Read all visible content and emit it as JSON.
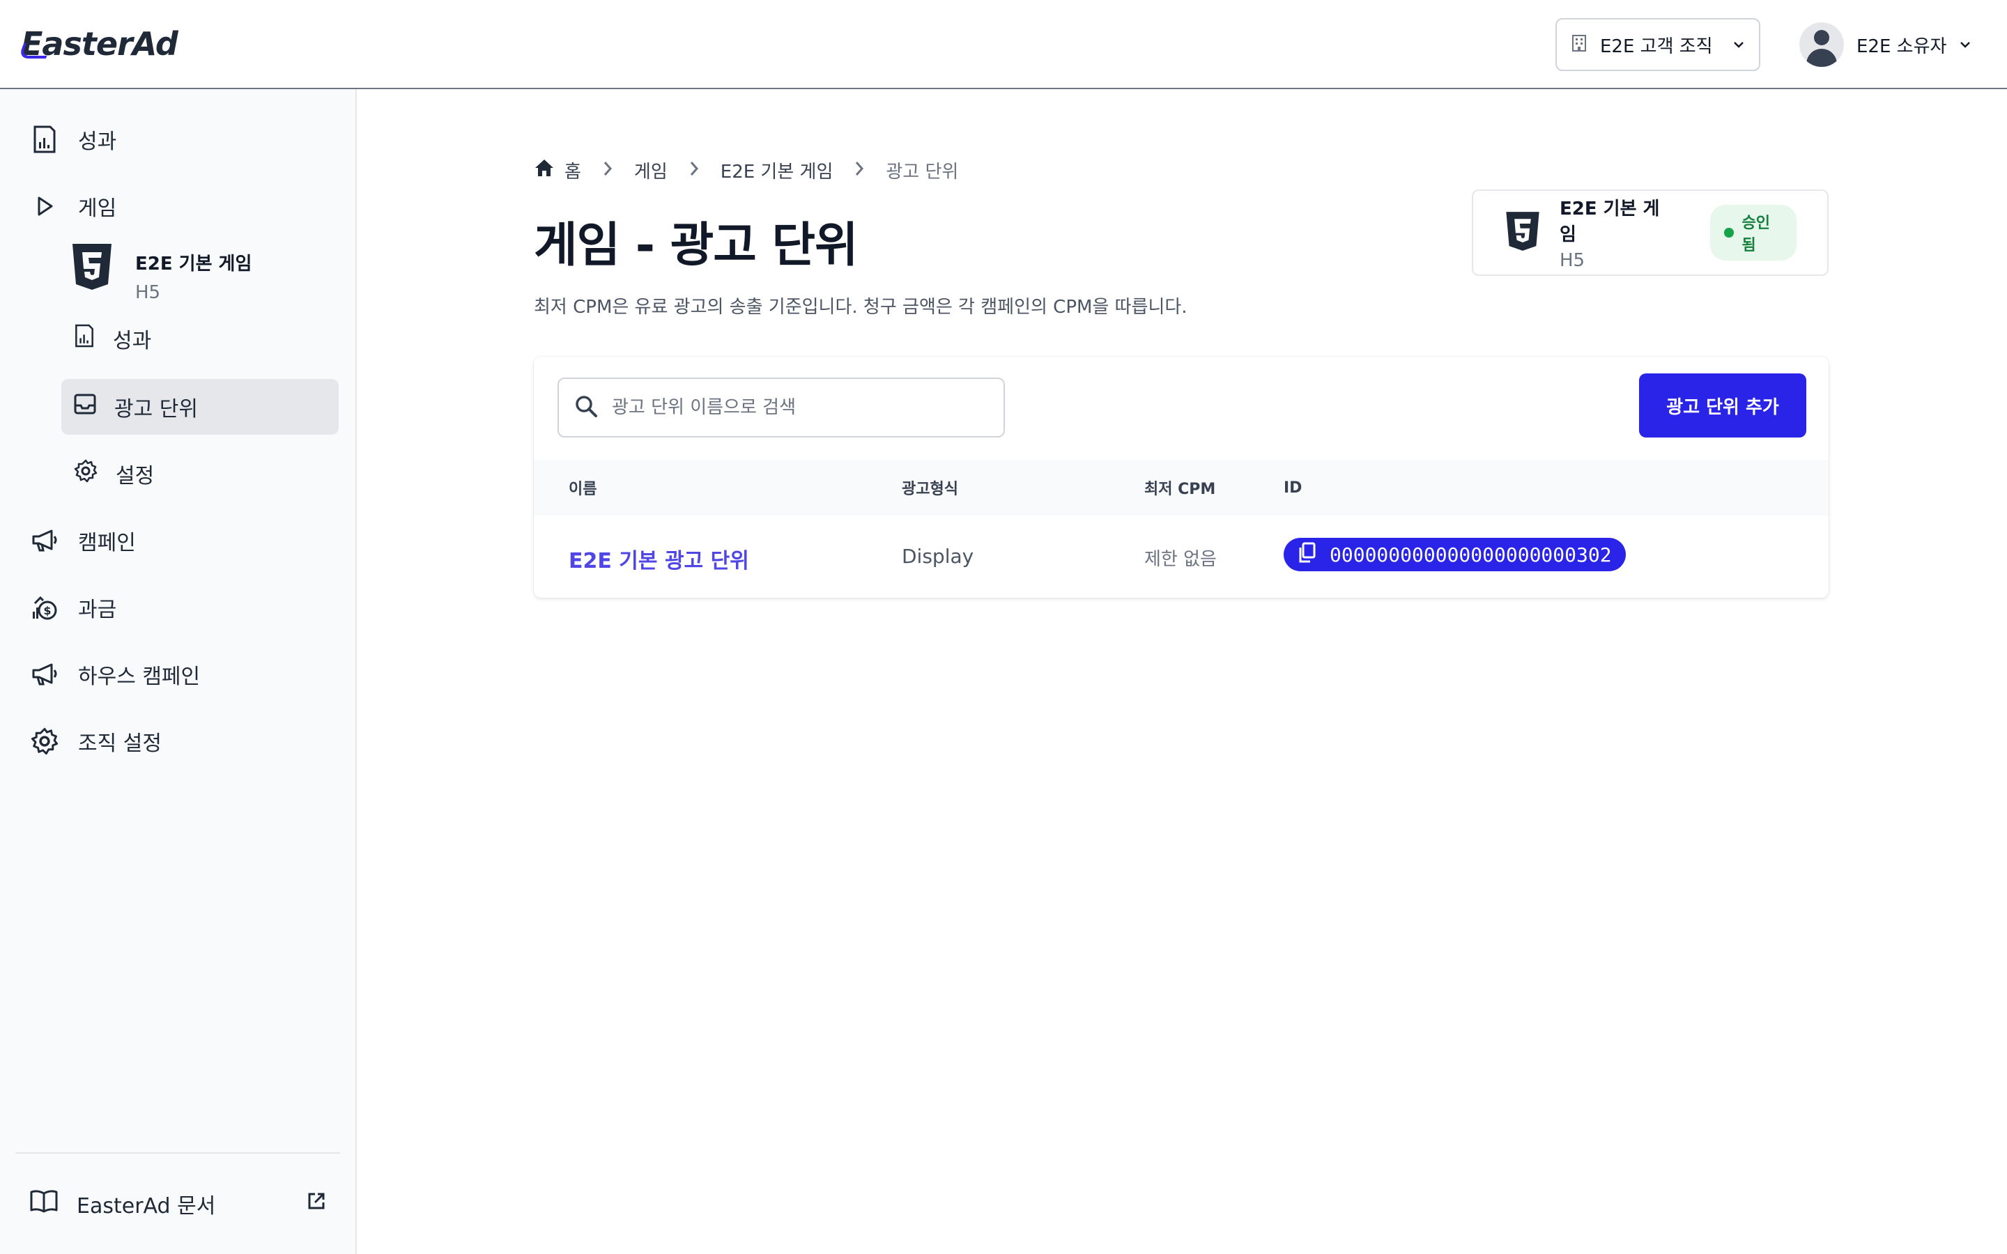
{
  "app": {
    "logo_text": "EasterAd"
  },
  "header": {
    "org_selector": {
      "label": "E2E 고객 조직",
      "icon": "building-icon"
    },
    "user": {
      "name": "E2E 소유자",
      "icon": "user-avatar-icon"
    }
  },
  "sidebar": {
    "items": [
      {
        "label": "성과",
        "icon": "report-chart-icon"
      },
      {
        "label": "게임",
        "icon": "play-icon"
      },
      {
        "label": "캠페인",
        "icon": "megaphone-icon"
      },
      {
        "label": "과금",
        "icon": "billing-icon"
      },
      {
        "label": "하우스 캠페인",
        "icon": "megaphone-icon"
      },
      {
        "label": "조직 설정",
        "icon": "gear-icon"
      }
    ],
    "game": {
      "name": "E2E 기본 게임",
      "platform": "H5",
      "icon": "html5-icon"
    },
    "game_subitems": [
      {
        "label": "성과",
        "icon": "report-chart-icon"
      },
      {
        "label": "광고 단위",
        "icon": "inbox-icon",
        "active": true
      },
      {
        "label": "설정",
        "icon": "gear-icon"
      }
    ],
    "docs": {
      "label": "EasterAd 문서",
      "icon": "book-icon",
      "external_icon": "external-link-icon"
    }
  },
  "breadcrumb": {
    "home": "홈",
    "items": [
      "게임",
      "E2E 기본 게임",
      "광고 단위"
    ]
  },
  "page": {
    "title": "게임 - 광고 단위",
    "description": "최저 CPM은 유료 광고의 송출 기준입니다. 청구 금액은 각 캠페인의 CPM을 따릅니다."
  },
  "game_card": {
    "name": "E2E 기본 게임",
    "platform": "H5",
    "status": "승인됨",
    "status_color": "#16a34a"
  },
  "search": {
    "placeholder": "광고 단위 이름으로 검색",
    "value": ""
  },
  "add_button": {
    "label": "광고 단위 추가"
  },
  "table": {
    "columns": [
      "이름",
      "광고형식",
      "최저 CPM",
      "ID"
    ],
    "rows": [
      {
        "name": "E2E 기본 광고 단위",
        "format": "Display",
        "min_cpm": "제한 없음",
        "id": "000000000000000000000302"
      }
    ]
  },
  "colors": {
    "accent": "#2a23e8",
    "link": "#4f46e5"
  }
}
